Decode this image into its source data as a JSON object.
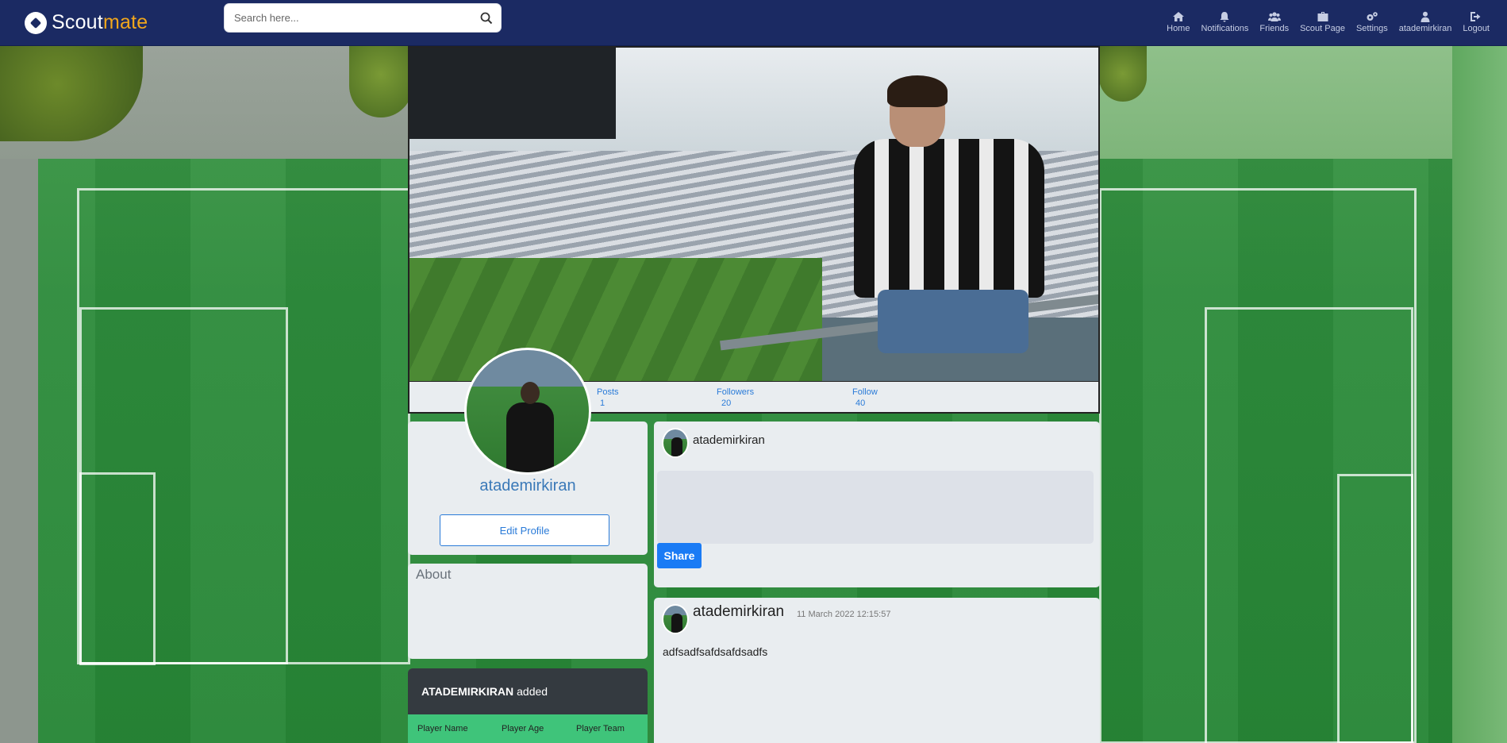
{
  "brand": {
    "name_main": "Scout",
    "name_accent": "mate",
    "accent_color": "#f0a61c"
  },
  "search": {
    "placeholder": "Search here..."
  },
  "nav": {
    "items": [
      {
        "label": "Home",
        "icon": "home-icon"
      },
      {
        "label": "Notifications",
        "icon": "bell-icon"
      },
      {
        "label": "Friends",
        "icon": "users-icon"
      },
      {
        "label": "Scout Page",
        "icon": "briefcase-icon"
      },
      {
        "label": "Settings",
        "icon": "gears-icon"
      },
      {
        "label": "atademirkiran",
        "icon": "user-icon"
      },
      {
        "label": "Logout",
        "icon": "logout-icon"
      }
    ]
  },
  "profile": {
    "username": "atademirkiran",
    "edit_label": "Edit Profile",
    "stats": {
      "posts_label": "Posts",
      "posts_value": "1",
      "followers_label": "Followers",
      "followers_value": "20",
      "follow_label": "Follow",
      "follow_value": "40"
    },
    "about_title": "About"
  },
  "added": {
    "user": "ATADEMIRKIRAN",
    "verb": "added",
    "columns": [
      "Player Name",
      "Player Age",
      "Player Team"
    ]
  },
  "composer": {
    "username": "atademirkiran",
    "share_label": "Share"
  },
  "post": {
    "username": "atademirkiran",
    "timestamp": "11 March 2022 12:15:57",
    "text": "adfsadfsafdsafdsadfs"
  },
  "colors": {
    "navbar": "#1b2a63",
    "link": "#2a7bd8",
    "share": "#1a7bf5",
    "card": "#e9edf0"
  }
}
